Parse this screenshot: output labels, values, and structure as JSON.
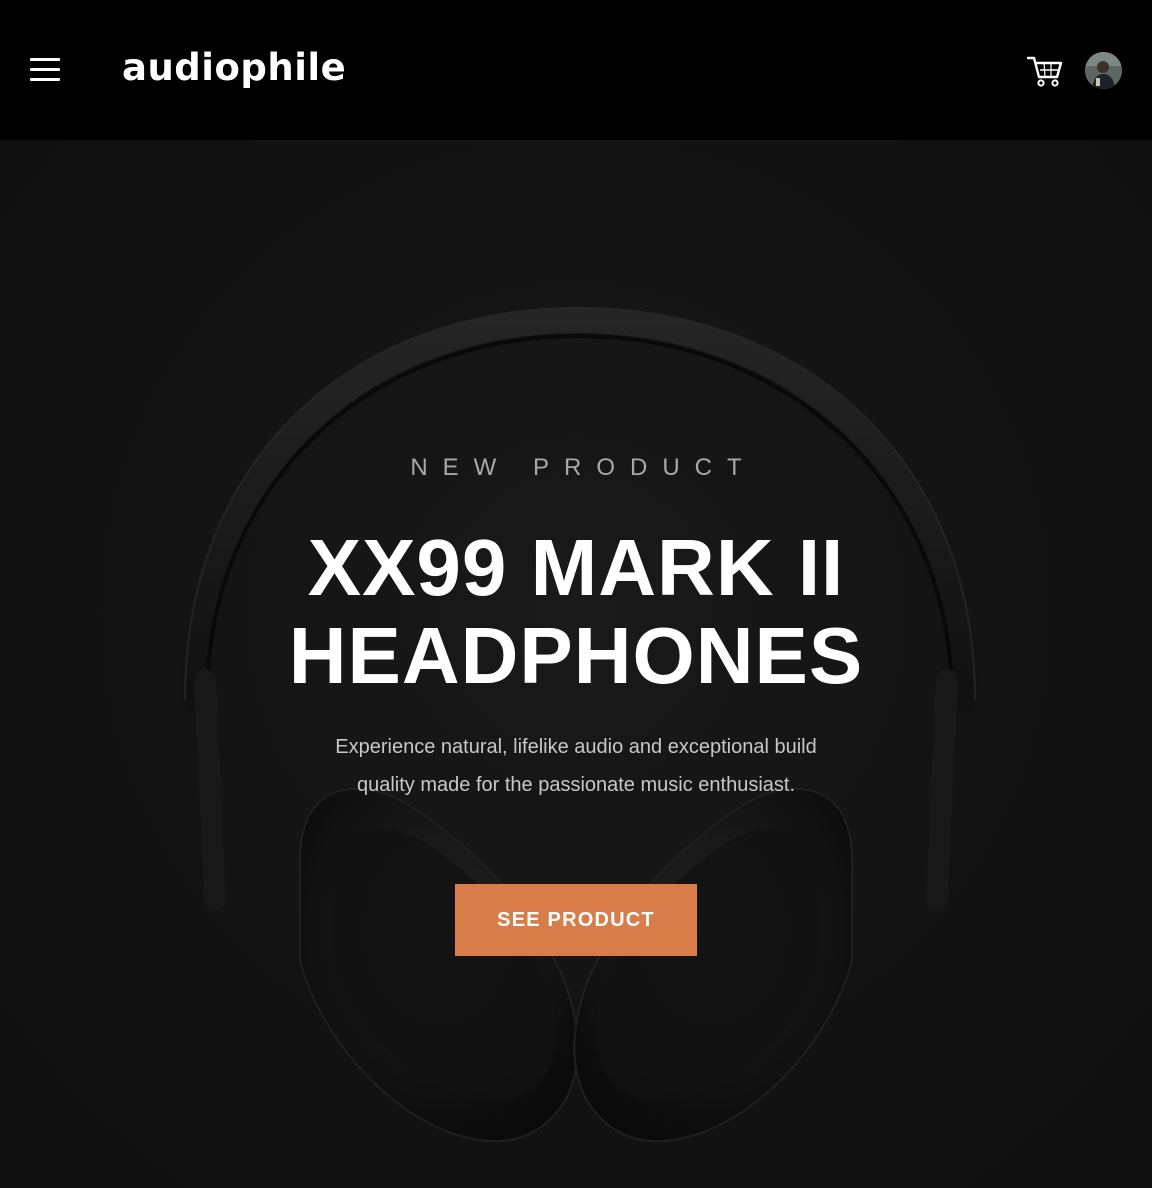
{
  "header": {
    "brand": "audiophile",
    "menu_icon": "hamburger-menu-icon",
    "cart_icon": "shopping-cart-icon",
    "avatar": "user-avatar"
  },
  "hero": {
    "overline": "NEW PRODUCT",
    "title_lines": [
      "XX99 MARK II",
      "HEADPHONES"
    ],
    "description": "Experience natural, lifelike audio and exceptional build quality made for the passionate music enthusiast.",
    "cta_label": "SEE PRODUCT",
    "background_image": "over-ear-headphones-photo"
  },
  "colors": {
    "accent": "#D87D4A",
    "header_bg": "#000000",
    "hero_bg": "#191919",
    "text_primary": "#FFFFFF",
    "text_muted": "#A8A8A8"
  }
}
